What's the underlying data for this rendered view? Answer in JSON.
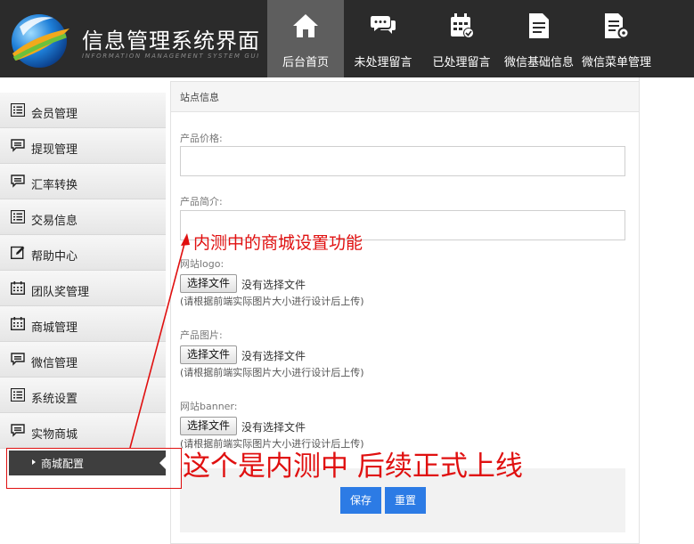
{
  "app": {
    "title": "信息管理系统界面",
    "subtitle": "INFORMATION MANAGEMENT SYSTEM GUI"
  },
  "nav": [
    {
      "label": "后台首页",
      "icon": "home-icon",
      "active": true
    },
    {
      "label": "未处理留言",
      "icon": "chat-bubbles-icon",
      "active": false
    },
    {
      "label": "已处理留言",
      "icon": "calendar-check-icon",
      "active": false
    },
    {
      "label": "微信基础信息",
      "icon": "document-icon",
      "active": false
    },
    {
      "label": "微信菜单管理",
      "icon": "document-gear-icon",
      "active": false
    }
  ],
  "sidebar": {
    "items": [
      {
        "label": "会员管理",
        "icon": "list-icon"
      },
      {
        "label": "提现管理",
        "icon": "comment-icon"
      },
      {
        "label": "汇率转换",
        "icon": "comment-icon"
      },
      {
        "label": "交易信息",
        "icon": "list-icon"
      },
      {
        "label": "帮助中心",
        "icon": "edit-icon"
      },
      {
        "label": "团队奖管理",
        "icon": "calendar-icon"
      },
      {
        "label": "商城管理",
        "icon": "calendar-icon"
      },
      {
        "label": "微信管理",
        "icon": "comment-icon"
      },
      {
        "label": "系统设置",
        "icon": "list-icon"
      },
      {
        "label": "实物商城",
        "icon": "comment-icon"
      }
    ],
    "sub_item": {
      "label": "商城配置",
      "active": true
    }
  },
  "form": {
    "section_title": "站点信息",
    "price_label": "产品价格:",
    "intro_label": "产品简介:",
    "logo_label": "网站logo:",
    "image_label": "产品图片:",
    "banner_label": "网站banner:",
    "file_button": "选择文件",
    "file_none": "没有选择文件",
    "file_hint": "(请根据前端实际图片大小进行设计后上传)",
    "save_button": "保存",
    "reset_button": "重置"
  },
  "annotations": {
    "note_top": "内测中的商城设置功能",
    "note_bottom": "这个是内测中  后续正式上线"
  },
  "colors": {
    "header_bg": "#2b2b2b",
    "nav_active_bg": "#5e5e5e",
    "sidebar_sub_bg": "#3e3e3e",
    "button_blue": "#2c7be5",
    "annotation_red": "#e01010"
  }
}
